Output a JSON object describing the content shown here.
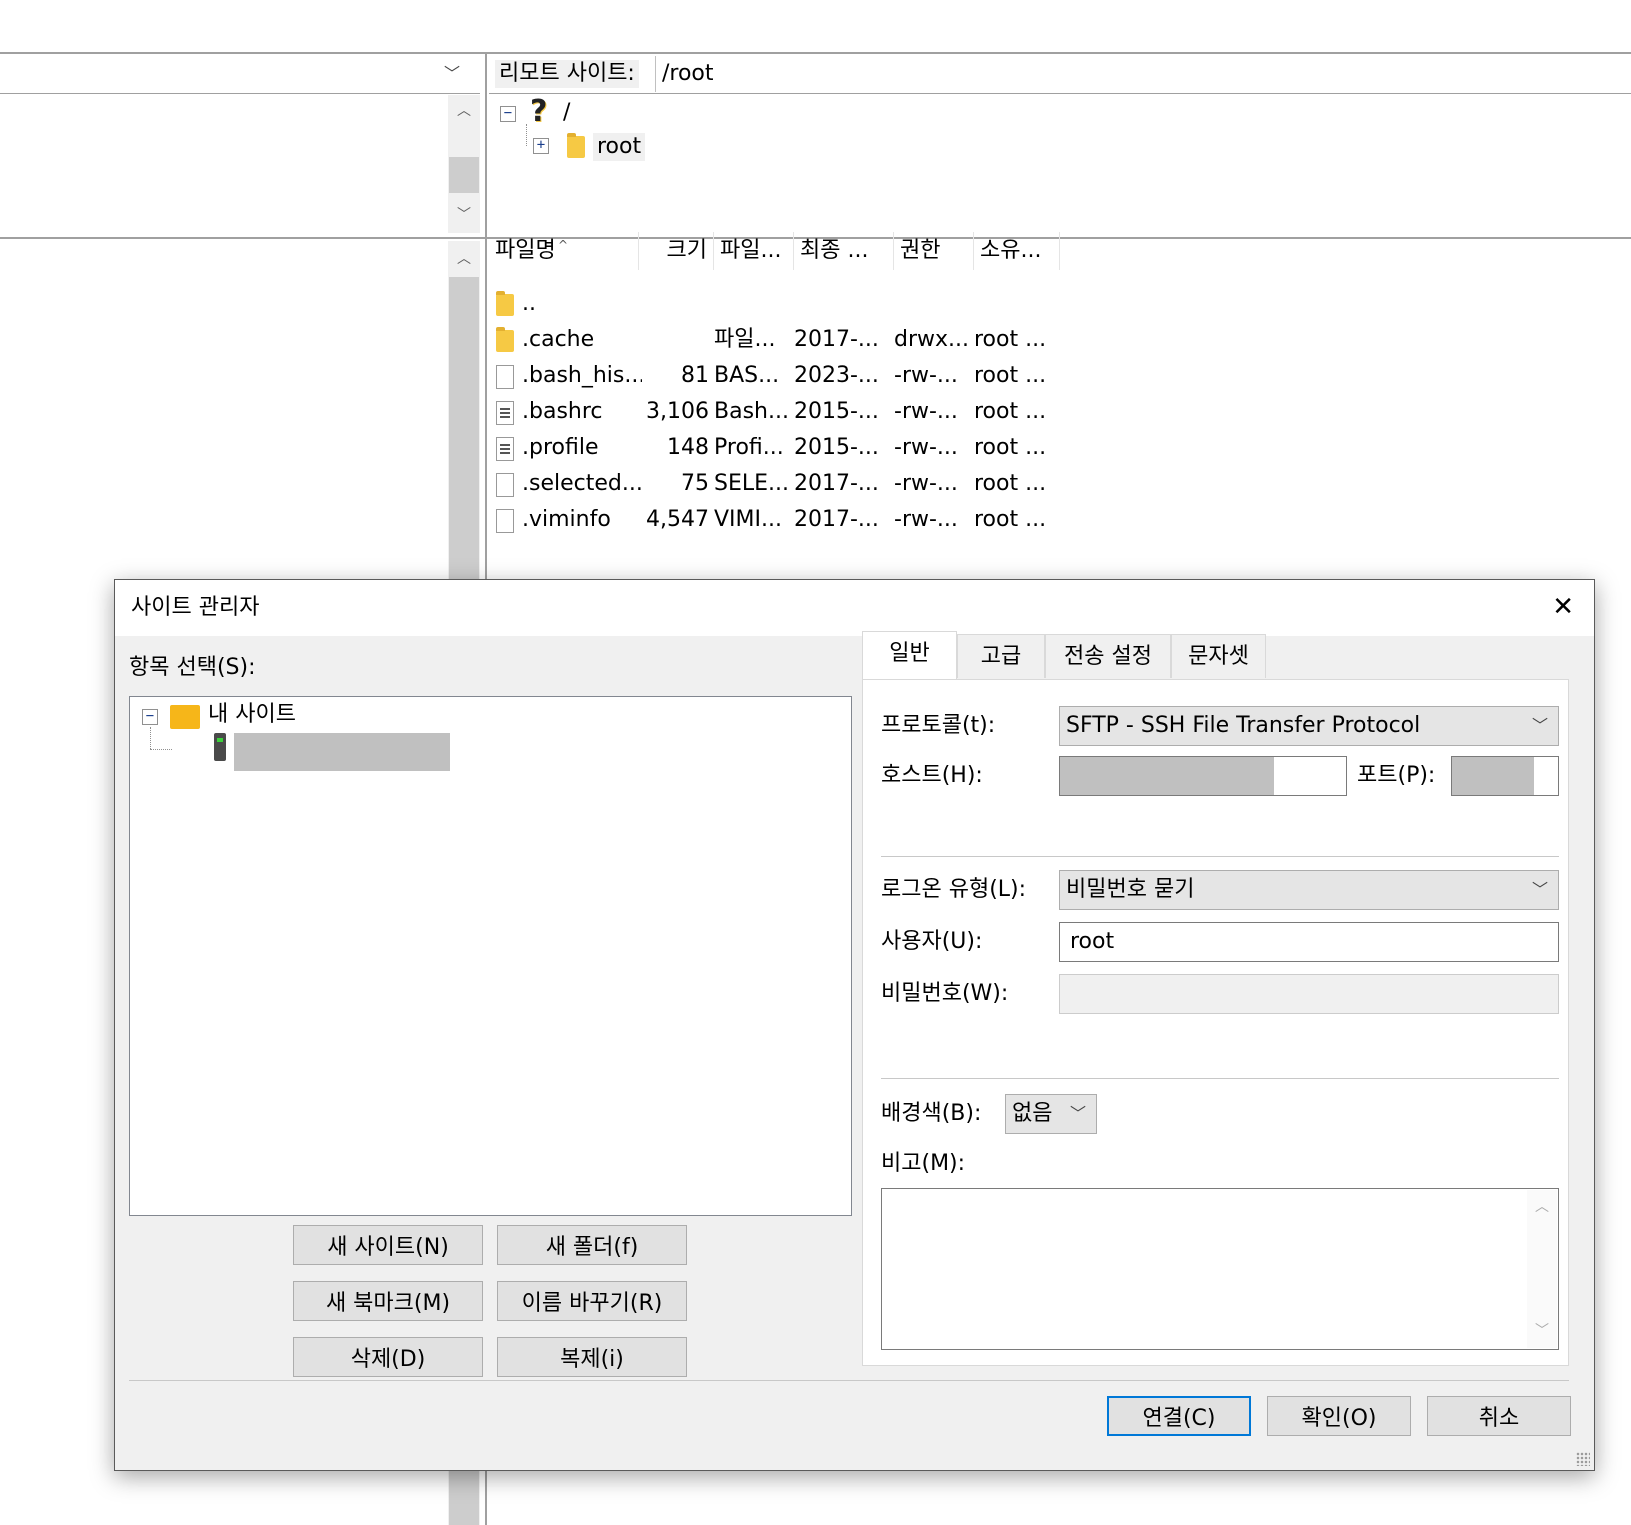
{
  "remote": {
    "site_label": "리모트 사이트:",
    "path": "/root",
    "tree": {
      "root_node": "/",
      "child_node": "root"
    },
    "columns": [
      "파일명",
      "크기",
      "파일...",
      "최종 ...",
      "권한",
      "소유..."
    ],
    "files": [
      {
        "name": "..",
        "size": "",
        "type": "",
        "modified": "",
        "perms": "",
        "owner": "",
        "icon": "folder-icon"
      },
      {
        "name": ".cache",
        "size": "",
        "type": "파일...",
        "modified": "2017-...",
        "perms": "drwx...",
        "owner": "root ...",
        "icon": "folder-icon"
      },
      {
        "name": ".bash_his...",
        "size": "81",
        "type": "BAS...",
        "modified": "2023-...",
        "perms": "-rw-...",
        "owner": "root ...",
        "icon": "file-icon"
      },
      {
        "name": ".bashrc",
        "size": "3,106",
        "type": "Bash...",
        "modified": "2015-...",
        "perms": "-rw-...",
        "owner": "root ...",
        "icon": "script-file-icon"
      },
      {
        "name": ".profile",
        "size": "148",
        "type": "Profi...",
        "modified": "2015-...",
        "perms": "-rw-...",
        "owner": "root ...",
        "icon": "script-file-icon"
      },
      {
        "name": ".selected...",
        "size": "75",
        "type": "SELE...",
        "modified": "2017-...",
        "perms": "-rw-...",
        "owner": "root ...",
        "icon": "file-icon"
      },
      {
        "name": ".viminfo",
        "size": "4,547",
        "type": "VIMI...",
        "modified": "2017-...",
        "perms": "-rw-...",
        "owner": "root ...",
        "icon": "file-icon"
      }
    ]
  },
  "dialog": {
    "title": "사이트 관리자",
    "close_glyph": "✕",
    "select_entry_label": "항목 선택(S):",
    "tree_root": "내 사이트",
    "buttons": {
      "new_site": "새 사이트(N)",
      "new_folder": "새 폴더(f)",
      "new_bookmark": "새 북마크(M)",
      "rename": "이름 바꾸기(R)",
      "delete": "삭제(D)",
      "duplicate": "복제(i)",
      "connect": "연결(C)",
      "ok": "확인(O)",
      "cancel": "취소"
    },
    "tabs": [
      "일반",
      "고급",
      "전송 설정",
      "문자셋"
    ],
    "general": {
      "protocol_label": "프로토콜(t):",
      "protocol_value": "SFTP - SSH File Transfer Protocol",
      "host_label": "호스트(H):",
      "port_label": "포트(P):",
      "logon_type_label": "로그온 유형(L):",
      "logon_type_value": "비밀번호 묻기",
      "user_label": "사용자(U):",
      "user_value": "root",
      "password_label": "비밀번호(W):",
      "bg_color_label": "배경색(B):",
      "bg_color_value": "없음",
      "comments_label": "비고(M):"
    },
    "accent_color": "#0078d7"
  }
}
